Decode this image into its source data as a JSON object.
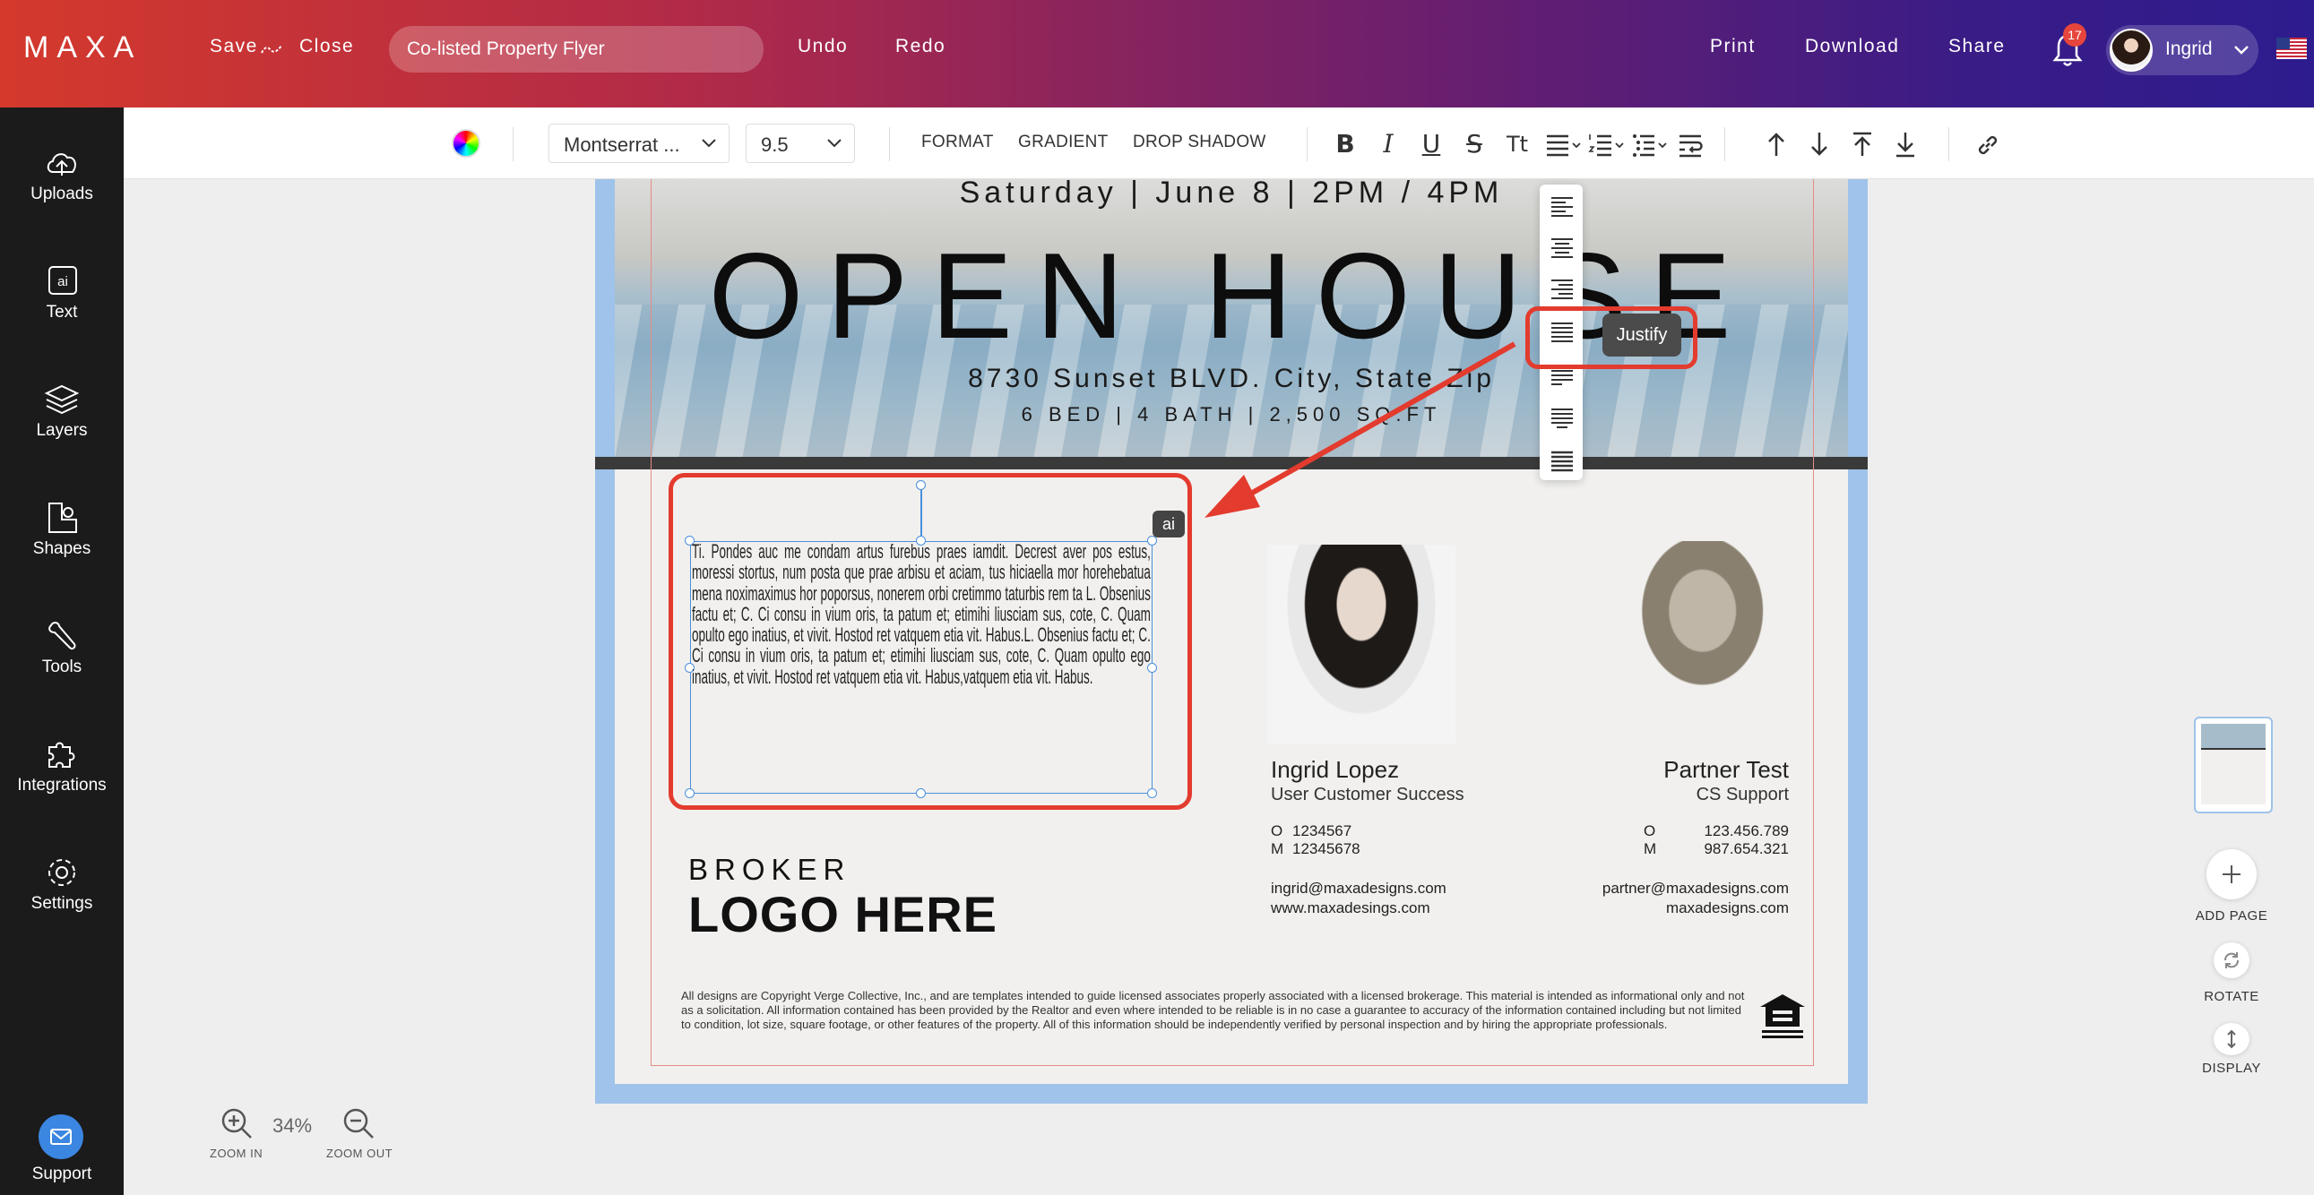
{
  "header": {
    "logo": "MAXA",
    "save_label": "Save",
    "close_label": "Close",
    "doc_title": "Co-listed Property Flyer",
    "undo_label": "Undo",
    "redo_label": "Redo",
    "print_label": "Print",
    "download_label": "Download",
    "share_label": "Share",
    "notification_count": "17",
    "user_name": "Ingrid"
  },
  "sidebar": {
    "items": [
      {
        "label": "Uploads",
        "icon": "cloud-upload-icon"
      },
      {
        "label": "Text",
        "icon": "ai-text-icon"
      },
      {
        "label": "Layers",
        "icon": "layers-icon"
      },
      {
        "label": "Shapes",
        "icon": "shapes-icon"
      },
      {
        "label": "Tools",
        "icon": "wrench-icon"
      },
      {
        "label": "Integrations",
        "icon": "puzzle-icon"
      },
      {
        "label": "Settings",
        "icon": "gear-icon"
      }
    ],
    "support_label": "Support"
  },
  "toolbar": {
    "font_family": "Montserrat ...",
    "font_size": "9.5",
    "format_label": "FORMAT",
    "gradient_label": "GRADIENT",
    "drop_shadow_label": "DROP SHADOW",
    "text_case_label": "Tt"
  },
  "flyer": {
    "date_line": "Saturday | June 8 | 2PM / 4PM",
    "headline": "OPEN HOUSE",
    "address": "8730 Sunset BLVD. City, State Zip",
    "details": "6 BED | 4 BATH | 2,500 SQ.FT",
    "description": "Ti. Pondes auc me condam artus furebus praes iamdit. Decrest aver pos estus, moressi stortus, num posta que prae arbisu et aciam, tus hiciaella mor horehebatua mena noximaximus hor poporsus, nonerem orbi cretimmo taturbis rem ta L. Obsenius factu et; C. Ci consu in vium oris, ta patum et; etimihi liusciam sus, cote, C. Quam opulto ego inatius, et vivit. Hostod ret vatquem etia vit. Habus.L. Obsenius factu et; C. Ci consu in vium oris, ta patum et; etimihi liusciam sus, cote, C. Quam opulto ego inatius, et vivit. Hostod ret vatquem etia vit. Habus,vatquem etia vit. Habus.",
    "ai_chip": "ai",
    "agent1": {
      "name": "Ingrid Lopez",
      "title": "User Customer Success",
      "office_prefix": "O",
      "office": "1234567",
      "mobile_prefix": "M",
      "mobile": "12345678",
      "email": "ingrid@maxadesigns.com",
      "website": "www.maxadesings.com"
    },
    "agent2": {
      "name": "Partner Test",
      "title": "CS Support",
      "office_prefix": "O",
      "office": "123.456.789",
      "mobile_prefix": "M",
      "mobile": "987.654.321",
      "email": "partner@maxadesigns.com",
      "website": "maxadesigns.com"
    },
    "broker_line1": "BROKER",
    "broker_line2": "LOGO HERE",
    "disclaimer": "All designs are Copyright Verge Collective, Inc., and are templates intended to guide licensed associates properly associated with a licensed brokerage. This material is intended as informational only and not as a solicitation. All information contained has been provided by the Realtor and even where intended to be reliable is in no case a guarantee to accuracy of the information contained including but not limited to condition, lot size, square footage, or other features of the property. All of this information should be independently verified by personal inspection and by hiring the appropriate professionals."
  },
  "align_popover": {
    "tooltip": "Justify",
    "options": [
      "align-left-icon",
      "align-center-icon",
      "align-right-icon",
      "align-justify-icon",
      "justify-last-left-icon",
      "justify-last-center-icon",
      "justify-all-icon"
    ]
  },
  "right_panel": {
    "add_page_label": "ADD PAGE",
    "rotate_label": "ROTATE",
    "display_label": "DISPLAY"
  },
  "zoom": {
    "value": "34%",
    "zoom_in_label": "ZOOM IN",
    "zoom_out_label": "ZOOM OUT"
  },
  "colors": {
    "accent_red": "#e33b2e",
    "selection_blue": "#4a8fdc",
    "sidebar_bg": "#1b1b1b",
    "support_blue": "#3b86e0"
  }
}
